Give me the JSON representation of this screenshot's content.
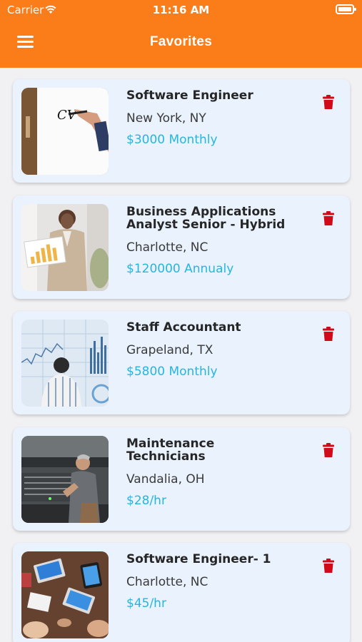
{
  "status_bar": {
    "carrier": "Carrier",
    "time": "11:16 AM"
  },
  "header": {
    "title": "Favorites",
    "menu_icon": "hamburger-menu-icon"
  },
  "colors": {
    "header": "#fb7d1a",
    "card": "#e9f2fd",
    "salary": "#27b5e0",
    "delete": "#d10a1a"
  },
  "jobs": [
    {
      "title": "Software Engineer",
      "location": "New York, NY",
      "salary": "$3000 Monthly",
      "image": "cv-whiteboard"
    },
    {
      "title": "Business Applications Analyst Senior - Hybrid",
      "location": "Charlotte, NC",
      "salary": "$120000 Annualy",
      "image": "woman-presenting-chart"
    },
    {
      "title": "Staff Accountant",
      "location": "Grapeland, TX",
      "salary": "$5800 Monthly",
      "image": "man-viewing-stock-chart"
    },
    {
      "title": "Maintenance Technicians",
      "location": "Vandalia, OH",
      "salary": "$28/hr",
      "image": "technician-at-machine"
    },
    {
      "title": "Software Engineer- 1",
      "location": "Charlotte, NC",
      "salary": "$45/hr",
      "image": "team-with-laptops"
    }
  ]
}
